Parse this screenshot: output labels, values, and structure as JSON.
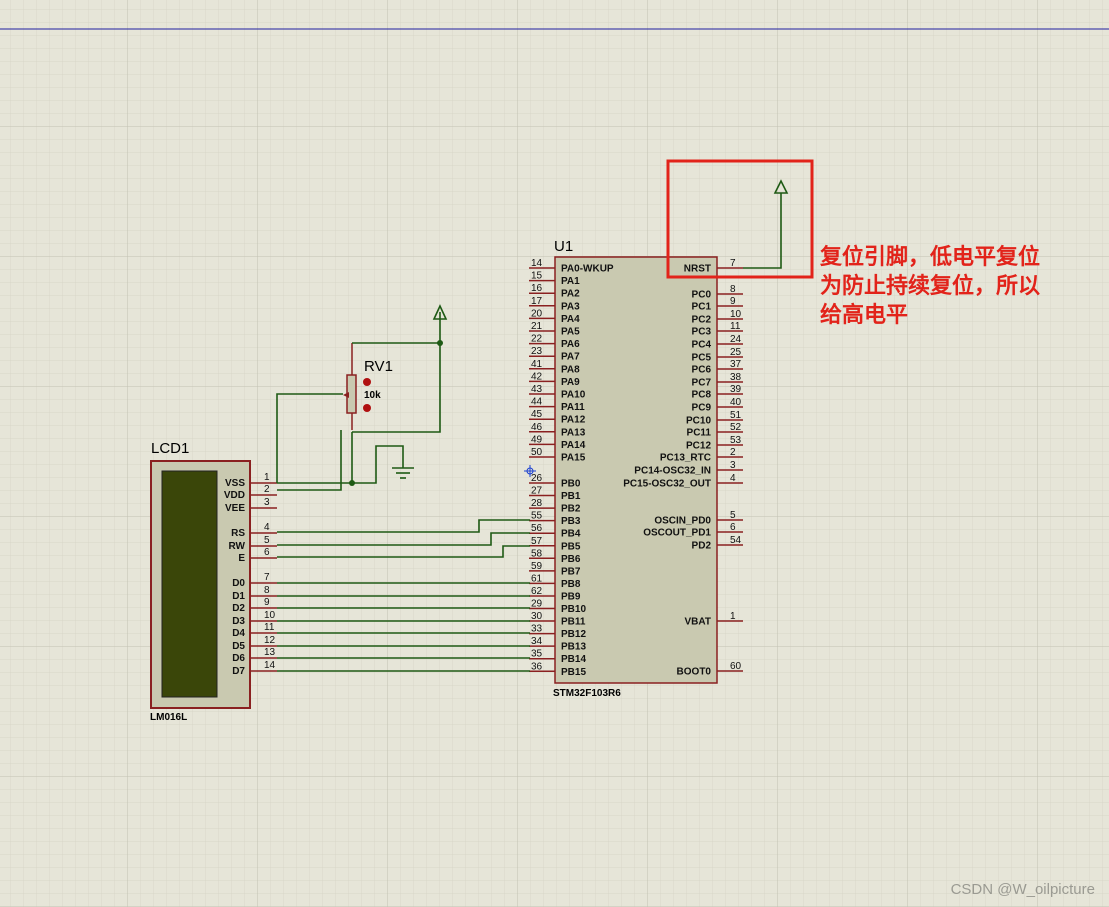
{
  "lcd": {
    "ref": "LCD1",
    "part": "LM016L",
    "pins": [
      {
        "name": "VSS",
        "num": "1"
      },
      {
        "name": "VDD",
        "num": "2"
      },
      {
        "name": "VEE",
        "num": "3"
      },
      {
        "name": "RS",
        "num": "4"
      },
      {
        "name": "RW",
        "num": "5"
      },
      {
        "name": "E",
        "num": "6"
      },
      {
        "name": "D0",
        "num": "7"
      },
      {
        "name": "D1",
        "num": "8"
      },
      {
        "name": "D2",
        "num": "9"
      },
      {
        "name": "D3",
        "num": "10"
      },
      {
        "name": "D4",
        "num": "11"
      },
      {
        "name": "D5",
        "num": "12"
      },
      {
        "name": "D6",
        "num": "13"
      },
      {
        "name": "D7",
        "num": "14"
      }
    ]
  },
  "pot": {
    "ref": "RV1",
    "value": "10k"
  },
  "mcu": {
    "ref": "U1",
    "part": "STM32F103R6",
    "left_pins": [
      {
        "name": "PA0-WKUP",
        "num": "14"
      },
      {
        "name": "PA1",
        "num": "15"
      },
      {
        "name": "PA2",
        "num": "16"
      },
      {
        "name": "PA3",
        "num": "17"
      },
      {
        "name": "PA4",
        "num": "20"
      },
      {
        "name": "PA5",
        "num": "21"
      },
      {
        "name": "PA6",
        "num": "22"
      },
      {
        "name": "PA7",
        "num": "23"
      },
      {
        "name": "PA8",
        "num": "41"
      },
      {
        "name": "PA9",
        "num": "42"
      },
      {
        "name": "PA10",
        "num": "43"
      },
      {
        "name": "PA11",
        "num": "44"
      },
      {
        "name": "PA12",
        "num": "45"
      },
      {
        "name": "PA13",
        "num": "46"
      },
      {
        "name": "PA14",
        "num": "49"
      },
      {
        "name": "PA15",
        "num": "50"
      },
      {
        "name": "PB0",
        "num": "26"
      },
      {
        "name": "PB1",
        "num": "27"
      },
      {
        "name": "PB2",
        "num": "28"
      },
      {
        "name": "PB3",
        "num": "55"
      },
      {
        "name": "PB4",
        "num": "56"
      },
      {
        "name": "PB5",
        "num": "57"
      },
      {
        "name": "PB6",
        "num": "58"
      },
      {
        "name": "PB7",
        "num": "59"
      },
      {
        "name": "PB8",
        "num": "61"
      },
      {
        "name": "PB9",
        "num": "62"
      },
      {
        "name": "PB10",
        "num": "29"
      },
      {
        "name": "PB11",
        "num": "30"
      },
      {
        "name": "PB12",
        "num": "33"
      },
      {
        "name": "PB13",
        "num": "34"
      },
      {
        "name": "PB14",
        "num": "35"
      },
      {
        "name": "PB15",
        "num": "36"
      }
    ],
    "right_pins": [
      {
        "name": "NRST",
        "num": "7"
      },
      {
        "name": "PC0",
        "num": "8"
      },
      {
        "name": "PC1",
        "num": "9"
      },
      {
        "name": "PC2",
        "num": "10"
      },
      {
        "name": "PC3",
        "num": "11"
      },
      {
        "name": "PC4",
        "num": "24"
      },
      {
        "name": "PC5",
        "num": "25"
      },
      {
        "name": "PC6",
        "num": "37"
      },
      {
        "name": "PC7",
        "num": "38"
      },
      {
        "name": "PC8",
        "num": "39"
      },
      {
        "name": "PC9",
        "num": "40"
      },
      {
        "name": "PC10",
        "num": "51"
      },
      {
        "name": "PC11",
        "num": "52"
      },
      {
        "name": "PC12",
        "num": "53"
      },
      {
        "name": "PC13_RTC",
        "num": "2"
      },
      {
        "name": "PC14-OSC32_IN",
        "num": "3"
      },
      {
        "name": "PC15-OSC32_OUT",
        "num": "4"
      },
      {
        "name": "OSCIN_PD0",
        "num": "5"
      },
      {
        "name": "OSCOUT_PD1",
        "num": "6"
      },
      {
        "name": "PD2",
        "num": "54"
      },
      {
        "name": "VBAT",
        "num": "1"
      },
      {
        "name": "BOOT0",
        "num": "60"
      }
    ]
  },
  "annotation": {
    "lines": [
      "复位引脚，低电平复位",
      "为防止持续复位，所以",
      "给高电平"
    ]
  },
  "colors": {
    "background": "#e6e5d8",
    "grid": "#cfcebf",
    "component_fill": "#c9c9b0",
    "component_border": "#8a2020",
    "lcd_screen": "#3a4609",
    "wire": "#1e5a14",
    "highlight": "#e2231a"
  },
  "watermark": "CSDN @W_oilpicture"
}
